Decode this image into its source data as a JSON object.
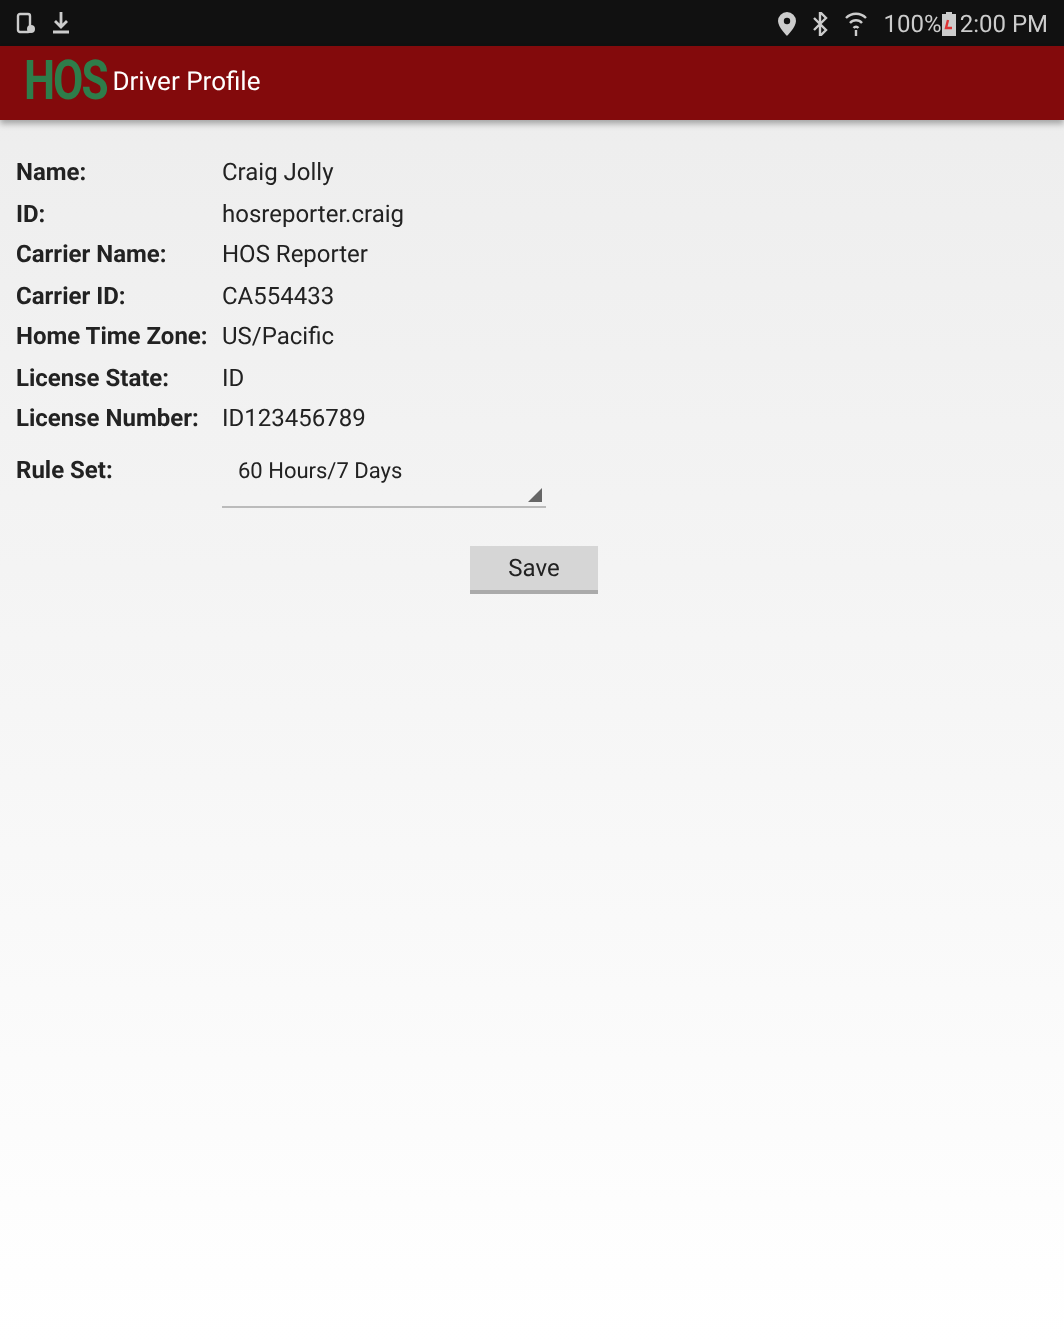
{
  "status_bar": {
    "battery": "100%",
    "time": "2:00 PM"
  },
  "app_bar": {
    "logo": "HOS",
    "title": "Driver Profile"
  },
  "fields": [
    {
      "label": "Name:",
      "value": "Craig Jolly"
    },
    {
      "label": "ID:",
      "value": "hosreporter.craig"
    },
    {
      "label": "Carrier Name:",
      "value": "HOS Reporter"
    },
    {
      "label": "Carrier ID:",
      "value": "CA554433"
    },
    {
      "label": "Home Time Zone:",
      "value": "US/Pacific"
    },
    {
      "label": "License State:",
      "value": "ID"
    },
    {
      "label": "License Number:",
      "value": "ID123456789"
    }
  ],
  "rule_set": {
    "label": "Rule Set:",
    "value": "60 Hours/7 Days"
  },
  "save_button": "Save"
}
